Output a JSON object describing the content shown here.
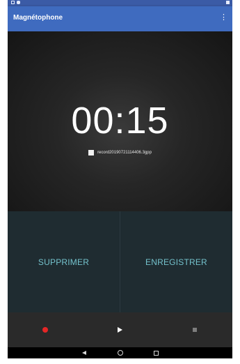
{
  "app": {
    "title": "Magnétophone"
  },
  "timer": {
    "value": "00:15"
  },
  "recording": {
    "filename": "record20190721114406.3gpp"
  },
  "actions": {
    "delete_label": "SUPPRIMER",
    "save_label": "ENREGISTRER"
  },
  "icons": {
    "overflow": "more-vert-icon",
    "record": "record-dot-icon",
    "play": "play-icon",
    "stop": "stop-icon",
    "back": "back-icon",
    "home": "home-icon",
    "recent": "recents-icon"
  },
  "colors": {
    "app_bar": "#3f6bbf",
    "status_bar": "#3b5ba6",
    "action_text": "#74c2cc",
    "record": "#e52626"
  }
}
